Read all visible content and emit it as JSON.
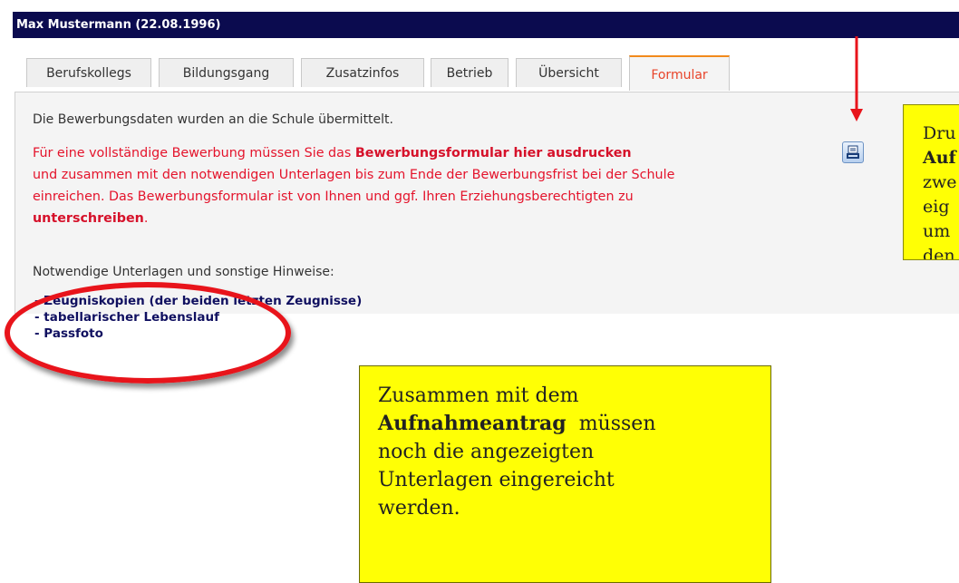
{
  "header": {
    "title": "Max Mustermann (22.08.1996)"
  },
  "tabs": [
    {
      "label": "Berufskollegs"
    },
    {
      "label": "Bildungsgang"
    },
    {
      "label": "Zusatzinfos"
    },
    {
      "label": "Betrieb"
    },
    {
      "label": "Übersicht"
    },
    {
      "label": "Formular",
      "active": true
    }
  ],
  "panel": {
    "status": "Die Bewerbungsdaten wurden an die Schule übermittelt.",
    "line1_pre": "Für eine vollständige Bewerbung müssen Sie das ",
    "line1_bold": "Bewerbungsformular hier ausdrucken",
    "line2": "und zusammen mit den notwendigen Unterlagen bis zum Ende der Bewerbungsfrist bei der Schule",
    "line3": "einreichen. Das Bewerbungsformular ist von Ihnen und ggf. Ihren Erziehungsberechtigten zu",
    "line4_bold": "unterschreiben",
    "line4_post": ".",
    "docs_heading": "Notwendige Unterlagen und sonstige Hinweise:",
    "docs": [
      "- Zeugniskopien (der beiden letzten Zeugnisse)",
      "- tabellarischer Lebenslauf",
      "- Passfoto"
    ],
    "print_icon": "printer-icon"
  },
  "notes": {
    "right": {
      "lines": [
        "Dru",
        "Auf",
        "zwe",
        "eig",
        "um",
        "den"
      ]
    },
    "bottom": {
      "line1": "Zusammen mit dem",
      "line2_bold": "Aufnahmeantrag",
      "line2_rest": "  müssen",
      "line3": "noch die angezeigten",
      "line4": "Unterlagen eingereicht",
      "line5": "werden."
    }
  },
  "colors": {
    "header_bg": "#0b0b4f",
    "active_tab": "#e8442a",
    "annotation_red": "#e8141b",
    "note_yellow": "#ffff05"
  }
}
